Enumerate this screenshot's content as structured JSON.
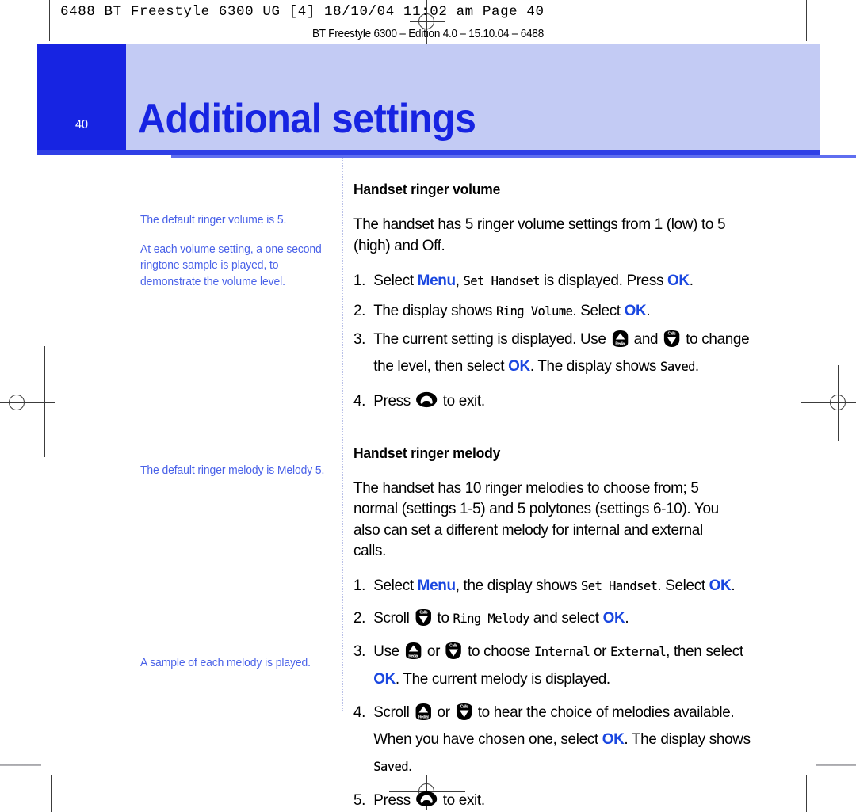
{
  "press": {
    "header_line": "6488 BT Freestyle 6300 UG [4]   18/10/04  11:02 am  Page 40",
    "edition_line": "BT Freestyle 6300 – Edition 4.0 – 15.10.04 – 6488"
  },
  "chapter": {
    "title": "Additional settings",
    "page_number": "40",
    "band_color": "#c3cbf4",
    "accent_color": "#1724e2"
  },
  "margin_notes": [
    {
      "text": "The default ringer volume is 5."
    },
    {
      "text": "At each volume setting, a one second ringtone sample is played, to demonstrate the volume level."
    },
    {
      "text": "The default ringer melody is Melody 5."
    },
    {
      "text": "A sample of each melody is played."
    }
  ],
  "sections": [
    {
      "heading": "Handset ringer volume",
      "intro": "The handset has 5 ringer volume settings from 1 (low) to 5 (high) and Off.",
      "steps": [
        {
          "parts": [
            {
              "type": "text",
              "value": "Select "
            },
            {
              "type": "keyword",
              "value": "Menu"
            },
            {
              "type": "text",
              "value": ", "
            },
            {
              "type": "lcd",
              "value": "Set Handset"
            },
            {
              "type": "text",
              "value": " is displayed. Press "
            },
            {
              "type": "keyword",
              "value": "OK"
            },
            {
              "type": "text",
              "value": "."
            }
          ]
        },
        {
          "parts": [
            {
              "type": "text",
              "value": "The display shows "
            },
            {
              "type": "lcd",
              "value": "Ring Volume"
            },
            {
              "type": "text",
              "value": ". Select "
            },
            {
              "type": "keyword",
              "value": "OK"
            },
            {
              "type": "text",
              "value": "."
            }
          ]
        },
        {
          "parts": [
            {
              "type": "text",
              "value": "The current setting is displayed. Use "
            },
            {
              "type": "icon",
              "value": "redial-up-key-icon"
            },
            {
              "type": "text",
              "value": " and "
            },
            {
              "type": "icon",
              "value": "calls-down-key-icon"
            },
            {
              "type": "text",
              "value": " to change the level, then select "
            },
            {
              "type": "keyword",
              "value": "OK"
            },
            {
              "type": "text",
              "value": ". The display shows "
            },
            {
              "type": "lcd",
              "value": "Saved"
            },
            {
              "type": "text",
              "value": "."
            }
          ]
        },
        {
          "parts": [
            {
              "type": "text",
              "value": "Press "
            },
            {
              "type": "icon",
              "value": "end-call-key-icon"
            },
            {
              "type": "text",
              "value": " to exit."
            }
          ]
        }
      ]
    },
    {
      "heading": "Handset ringer melody",
      "intro": "The handset has 10 ringer melodies to choose from; 5 normal (settings 1-5) and 5 polytones (settings 6-10). You also can set a different melody for internal and external calls.",
      "steps": [
        {
          "parts": [
            {
              "type": "text",
              "value": "Select "
            },
            {
              "type": "keyword",
              "value": "Menu"
            },
            {
              "type": "text",
              "value": ", the display shows "
            },
            {
              "type": "lcd",
              "value": "Set Handset"
            },
            {
              "type": "text",
              "value": ". Select "
            },
            {
              "type": "keyword",
              "value": "OK"
            },
            {
              "type": "text",
              "value": "."
            }
          ]
        },
        {
          "parts": [
            {
              "type": "text",
              "value": "Scroll "
            },
            {
              "type": "icon",
              "value": "calls-down-key-icon"
            },
            {
              "type": "text",
              "value": " to "
            },
            {
              "type": "lcd",
              "value": "Ring Melody"
            },
            {
              "type": "text",
              "value": " and select "
            },
            {
              "type": "keyword",
              "value": "OK"
            },
            {
              "type": "text",
              "value": "."
            }
          ]
        },
        {
          "parts": [
            {
              "type": "text",
              "value": "Use "
            },
            {
              "type": "icon",
              "value": "redial-up-key-icon"
            },
            {
              "type": "text",
              "value": " or "
            },
            {
              "type": "icon",
              "value": "calls-down-key-icon"
            },
            {
              "type": "text",
              "value": " to choose "
            },
            {
              "type": "lcd",
              "value": "Internal"
            },
            {
              "type": "text",
              "value": " or "
            },
            {
              "type": "lcd",
              "value": "External"
            },
            {
              "type": "text",
              "value": ", then select "
            },
            {
              "type": "keyword",
              "value": "OK"
            },
            {
              "type": "text",
              "value": ". The current melody is displayed."
            }
          ]
        },
        {
          "parts": [
            {
              "type": "text",
              "value": "Scroll "
            },
            {
              "type": "icon",
              "value": "redial-up-key-icon"
            },
            {
              "type": "text",
              "value": " or "
            },
            {
              "type": "icon",
              "value": "calls-down-key-icon"
            },
            {
              "type": "text",
              "value": " to hear the choice of melodies available. When you have chosen one, select "
            },
            {
              "type": "keyword",
              "value": "OK"
            },
            {
              "type": "text",
              "value": ". The display shows "
            },
            {
              "type": "lcd",
              "value": "Saved"
            },
            {
              "type": "text",
              "value": "."
            }
          ]
        },
        {
          "parts": [
            {
              "type": "text",
              "value": "Press "
            },
            {
              "type": "icon",
              "value": "end-call-key-icon"
            },
            {
              "type": "text",
              "value": " to exit."
            }
          ]
        }
      ]
    }
  ],
  "key_icons": {
    "redial-up-key-icon": {
      "label": "Redial",
      "direction": "up"
    },
    "calls-down-key-icon": {
      "label": "Calls",
      "direction": "down"
    },
    "end-call-key-icon": {
      "label": "End call",
      "direction": "none"
    }
  }
}
